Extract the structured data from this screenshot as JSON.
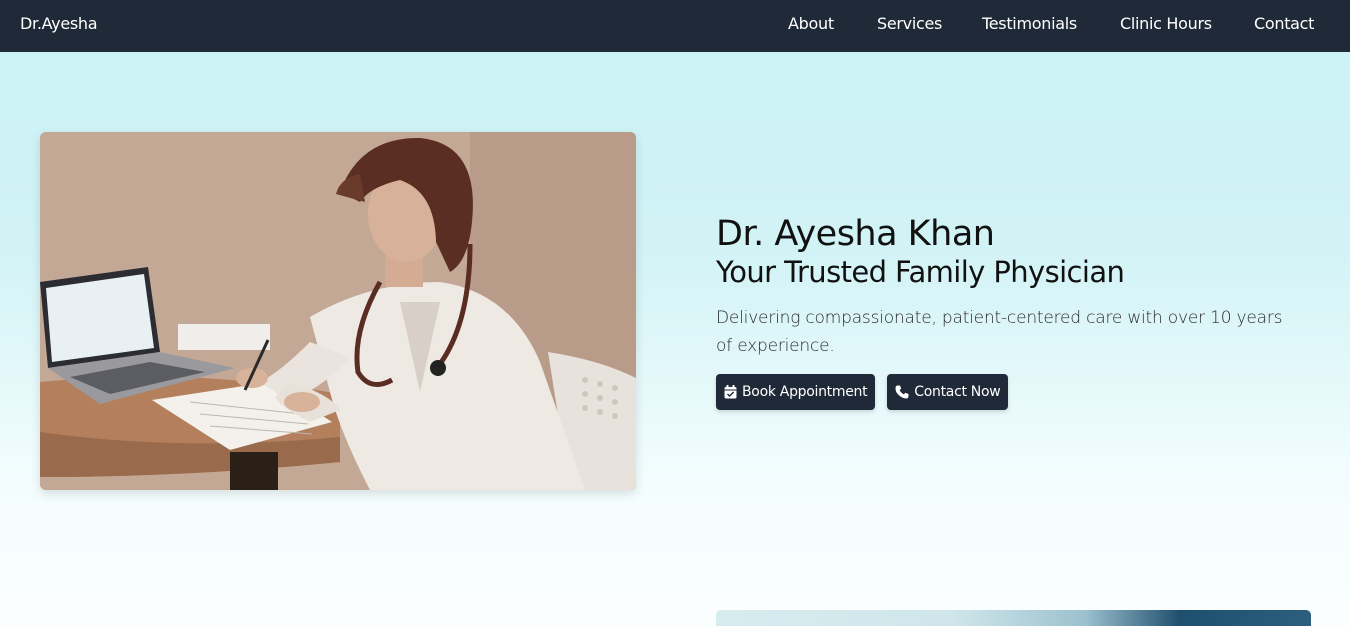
{
  "brand": "Dr.Ayesha",
  "nav": {
    "about": "About",
    "services": "Services",
    "testimonials": "Testimonials",
    "clinic_hours": "Clinic Hours",
    "contact": "Contact"
  },
  "hero": {
    "name": "Dr. Ayesha Khan",
    "tagline": "Your Trusted Family Physician",
    "description": "Delivering compassionate, patient-centered care with over 10 years of experience.",
    "book_label": "Book Appointment",
    "contact_label": "Contact Now",
    "book_icon": "calendar-check-icon",
    "contact_icon": "phone-icon"
  },
  "colors": {
    "navbar": "#1f2937",
    "button": "#1f2937",
    "hero_bg_top": "#c9f1f5",
    "hero_bg_bottom": "#fbfefe"
  }
}
